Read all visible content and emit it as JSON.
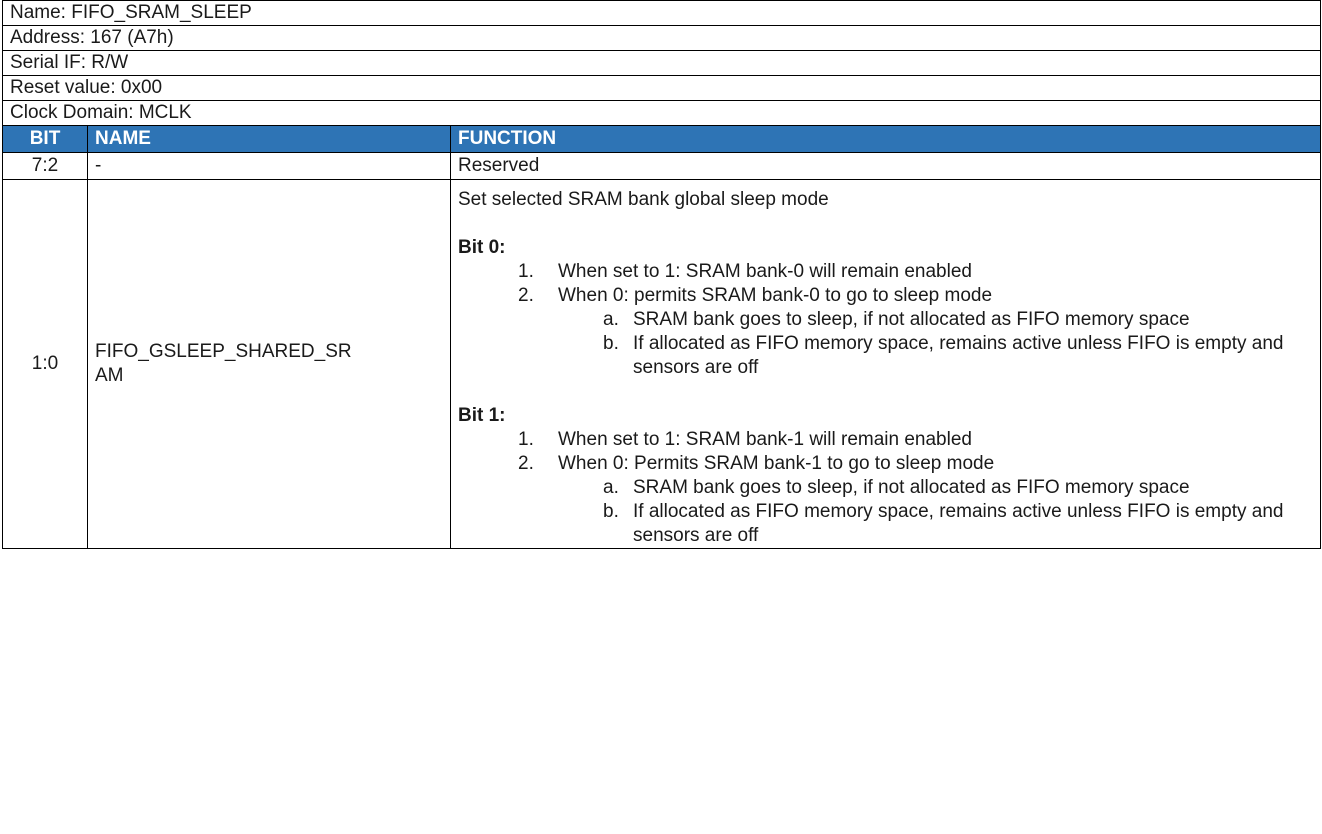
{
  "register": {
    "name": "Name: FIFO_SRAM_SLEEP",
    "address": "Address: 167 (A7h)",
    "serial_if": "Serial IF: R/W",
    "reset_value": "Reset value: 0x00",
    "clock_domain": "Clock Domain: MCLK"
  },
  "columns": {
    "bit": "BIT",
    "name": "NAME",
    "function": "FUNCTION"
  },
  "rows": [
    {
      "bit": "7:2",
      "name": "-",
      "function": "Reserved"
    },
    {
      "bit": "1:0",
      "name_line1": "FIFO_GSLEEP_SHARED_SR",
      "name_line2": "AM",
      "intro": "Set selected SRAM bank global sleep mode",
      "bit0": {
        "label": "Bit 0:",
        "item1_num": "1.",
        "item1": "When set to 1:  SRAM bank-0  will remain enabled",
        "item2_num": "2.",
        "item2": "When 0:  permits SRAM bank-0 to go to sleep mode",
        "sub_a_num": "a.",
        "sub_a": "SRAM bank goes to sleep, if not allocated as FIFO memory space",
        "sub_b_num": "b.",
        "sub_b": "If allocated as FIFO memory space, remains active unless FIFO is empty and sensors are off"
      },
      "bit1": {
        "label": "Bit 1:",
        "item1_num": "1.",
        "item1": "When set to 1:  SRAM bank-1  will remain enabled",
        "item2_num": "2.",
        "item2": "When 0:  Permits SRAM bank-1 to go to sleep mode",
        "sub_a_num": "a.",
        "sub_a": "SRAM bank goes to sleep, if not allocated as FIFO memory space",
        "sub_b_num": "b.",
        "sub_b": "If allocated as FIFO memory space, remains active unless FIFO is empty and sensors are off"
      }
    }
  ]
}
